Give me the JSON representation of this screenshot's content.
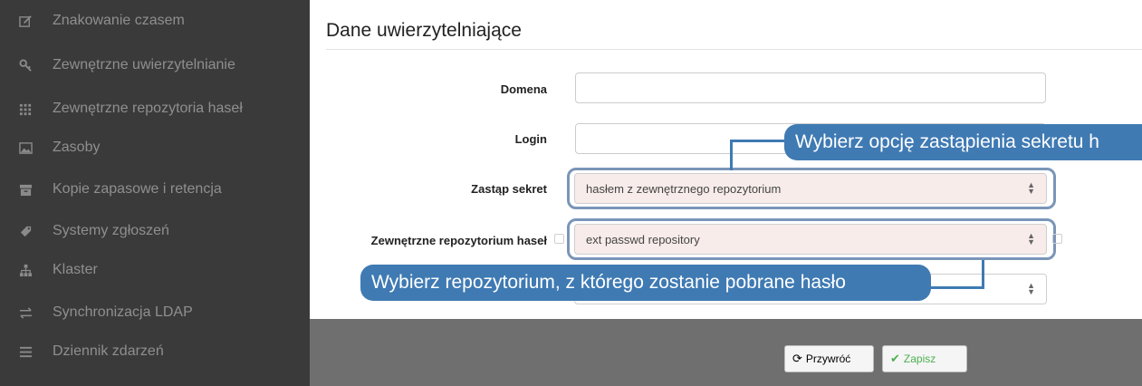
{
  "sidebar": {
    "items": [
      {
        "label": "Znakowanie czasem",
        "icon": "edit-icon"
      },
      {
        "label": "Zewnętrzne uwierzytelnianie",
        "icon": "key-icon"
      },
      {
        "label": "Zewnętrzne repozytoria haseł",
        "icon": "grid-icon"
      },
      {
        "label": "Zasoby",
        "icon": "image-icon"
      },
      {
        "label": "Kopie zapasowe i retencja",
        "icon": "archive-icon"
      },
      {
        "label": "Systemy zgłoszeń",
        "icon": "tag-icon"
      },
      {
        "label": "Klaster",
        "icon": "sitemap-icon"
      },
      {
        "label": "Synchronizacja LDAP",
        "icon": "exchange-icon"
      },
      {
        "label": "Dziennik zdarzeń",
        "icon": "list-icon"
      }
    ]
  },
  "main": {
    "title": "Dane uwierzytelniające",
    "fields": {
      "domain_label": "Domena",
      "domain_value": "",
      "login_label": "Login",
      "login_value": "",
      "replace_secret_label": "Zastąp sekret",
      "replace_secret_value": "hasłem z zewnętrznego repozytorium",
      "repository_label": "Zewnętrzne repozytorium haseł",
      "repository_value": "ext passwd repository",
      "extra_select_value": ""
    }
  },
  "callouts": {
    "replace_secret": "Wybierz opcję zastąpienia sekretu h",
    "repository": "Wybierz repozytorium, z którego zostanie pobrane hasło"
  },
  "footer": {
    "revert_label": "Przywróć",
    "save_label": "Zapisz"
  },
  "colors": {
    "sidebar_bg": "#3a3a3a",
    "callout": "#3f7ab3",
    "save_check": "#4caf50",
    "highlight": "#7a95b8"
  }
}
